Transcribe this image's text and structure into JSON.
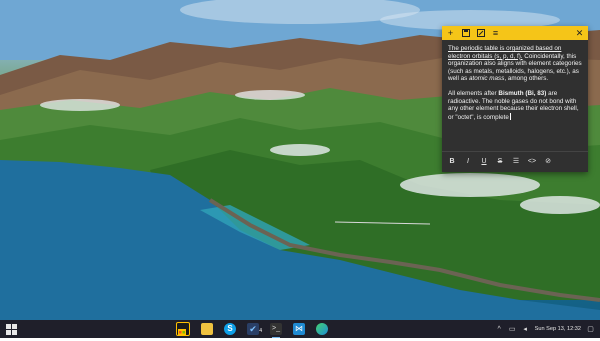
{
  "sticky_note": {
    "titlebar_icons": [
      "add-icon",
      "save-icon",
      "edit-icon",
      "menu-icon",
      "close-icon"
    ],
    "para1": {
      "seg1": "The periodic table is organized based on electron orbitals (s, p, d, f).",
      "seg2": " Coincidentally, this organization also aligns with element categories (such as metals, metalloids, halogens, etc.), as well as ",
      "seg3": "atomic mass",
      "seg4": ", among others."
    },
    "para2": {
      "seg1": "All elements after ",
      "seg2": "Bismuth (Bi, 83)",
      "seg3": " are radioactive. The noble gases do not bond with any other element because their electron shell, or \"octet\", is complete"
    },
    "format_buttons": {
      "bold": "B",
      "italic": "I",
      "underline": "U",
      "strike": "S",
      "list": "☰",
      "code": "<>",
      "link": "⊘"
    }
  },
  "taskbar": {
    "apps": [
      "store",
      "file-explorer",
      "skype",
      "tasks",
      "terminal",
      "vscode",
      "edge"
    ],
    "tasks_badge": "4",
    "clock": "Sun Sep 13, 12:32"
  },
  "colors": {
    "note_accent": "#f5c518",
    "note_background": "#303030",
    "taskbar": "#1f1f2a"
  }
}
